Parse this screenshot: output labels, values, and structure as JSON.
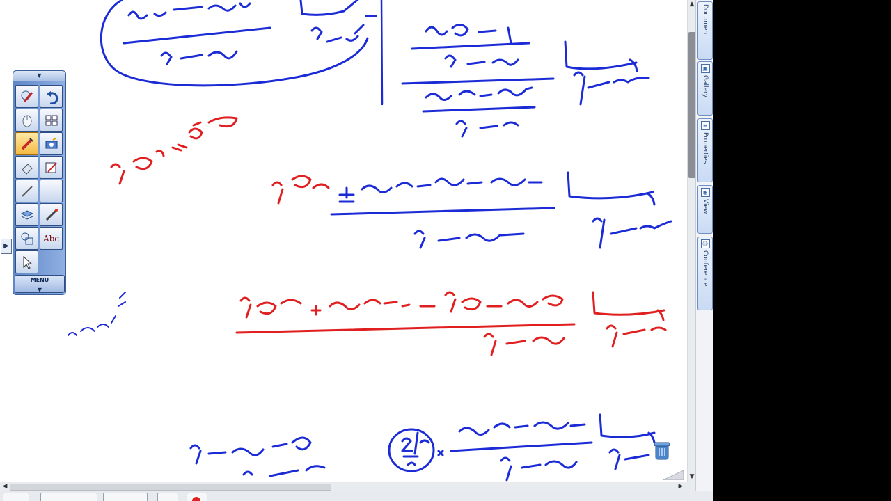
{
  "side_tabs": [
    "Document",
    "Gallery",
    "Properties",
    "View",
    "Conference"
  ],
  "toolbox": {
    "menu_label": "MENU",
    "text_tool_label": "Abc",
    "tools": [
      "pen-tool-icon",
      "undo-icon",
      "mouse-icon",
      "thumbnails-icon",
      "highlighter-icon",
      "capture-icon",
      "eraser-icon",
      "pen-settings-icon",
      "line-tool-icon",
      "blank-tool-icon",
      "layers-icon",
      "laser-pointer-icon",
      "shapes-icon",
      "text-tool-icon",
      "pointer-icon"
    ],
    "active_tool": "highlighter-icon"
  },
  "colors": {
    "ink_blue": "#1b2bd6",
    "ink_red": "#e02020",
    "toolbox_blue": "#5f86c6",
    "active_tool": "#f5b942"
  },
  "handwritten_math": {
    "blue_1": "lim (جا س − جتا س)/(س − π/٤) ; (١ − ظا س)/(س − π/٤)",
    "red_1": "جا π/٤ = جتا π/٤",
    "blue_2": "lim (جا س − جتا س ± جا π/٤)/(س − π/٤)",
    "red_2": "lim (جا س − جا π/٤ − جتا س + جتا π/٤)/(س − π/٤)",
    "blue_3": "ص = س − π/٤",
    "blue_4": "lim (جا س − جتا س)/(س − π/٤) × (√٢/٢)"
  }
}
